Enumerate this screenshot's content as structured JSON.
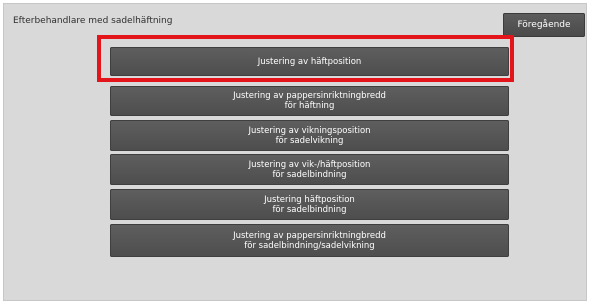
{
  "header": {
    "title": "Efterbehandlare med sadelhäftning",
    "back_label": "Föregående"
  },
  "menu": {
    "items": [
      {
        "label": "Justering av häftposition"
      },
      {
        "label": "Justering av pappersinriktningbredd\nför häftning"
      },
      {
        "label": "Justering av vikningsposition\nför sadelvikning"
      },
      {
        "label": "Justering av vik-/häftposition\nför sadelbindning"
      },
      {
        "label": "Justering häftposition\nför sadelbindning"
      },
      {
        "label": "Justering av pappersinriktningbredd\nför sadelbindning/sadelvikning"
      }
    ]
  },
  "colors": {
    "highlight": "#e4141b",
    "button": "#545454",
    "panel": "#d9d9d9"
  }
}
